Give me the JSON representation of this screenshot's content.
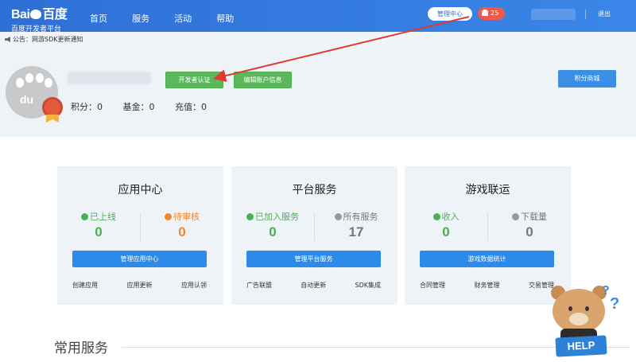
{
  "header": {
    "logo_text": "Bai",
    "logo_text2": "百度",
    "logo_subtitle": "百度开发者平台",
    "nav": [
      "首页",
      "服务",
      "活动",
      "帮助"
    ],
    "manage_center": "管理中心",
    "notice_count": "25",
    "logout": "退出"
  },
  "announcement": "公告：网游SDK更新通知",
  "profile": {
    "avatar_text": "du",
    "cert_button": "开发者认证",
    "edit_button": "编辑账户信息",
    "mall_button": "积分商城",
    "points": "积分：0",
    "fund": "基金：0",
    "recharge": "充值：0"
  },
  "cards": [
    {
      "title": "应用中心",
      "stats": [
        {
          "label": "已上线",
          "value": "0",
          "color": "#4caf50"
        },
        {
          "label": "待审核",
          "value": "0",
          "color": "#f0862d"
        }
      ],
      "button": "管理应用中心",
      "links": [
        "创建应用",
        "应用更新",
        "应用认领"
      ]
    },
    {
      "title": "平台服务",
      "stats": [
        {
          "label": "已加入服务",
          "value": "0",
          "color": "#4caf50"
        },
        {
          "label": "所有服务",
          "value": "17",
          "color": "#777777"
        }
      ],
      "button": "管理平台服务",
      "links": [
        "广告联盟",
        "自动更新",
        "SDK集成"
      ]
    },
    {
      "title": "游戏联运",
      "stats": [
        {
          "label": "收入",
          "value": "0",
          "color": "#4caf50"
        },
        {
          "label": "下载量",
          "value": "0",
          "color": "#777777"
        }
      ],
      "button": "游戏数据统计",
      "links": [
        "合同管理",
        "财务管理",
        "交易管理"
      ]
    }
  ],
  "common_services": "常用服务",
  "help": {
    "sign": "HELP",
    "qmark": "?"
  },
  "colors": {
    "header_blue": "#2e6fd6",
    "button_green": "#5cb85c",
    "button_blue": "#2d8ae8",
    "badge_red": "#f15a4a"
  }
}
